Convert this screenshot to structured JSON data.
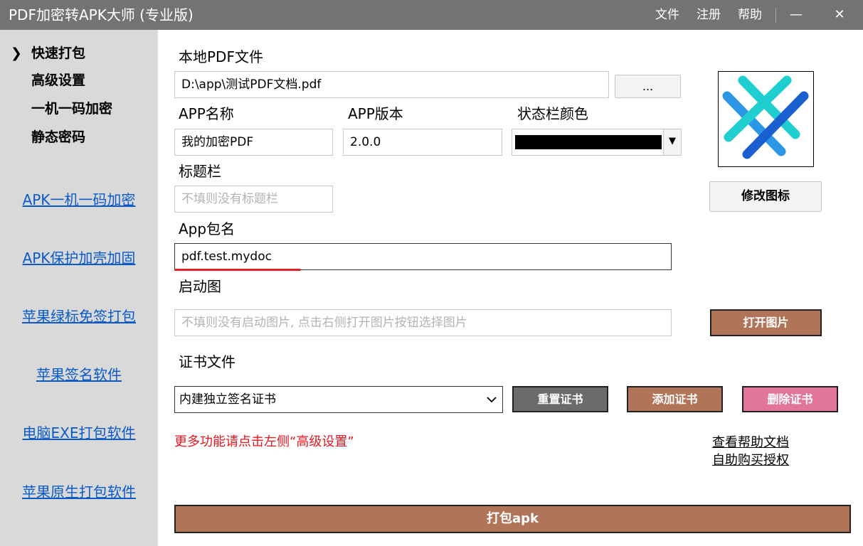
{
  "window": {
    "title": "PDF加密转APK大师 (专业版)",
    "menu": [
      "文件",
      "注册",
      "帮助"
    ],
    "minimize_glyph": "—",
    "close_glyph": "✕"
  },
  "sidebar": {
    "active_marker": "❯",
    "nav": [
      "快速打包",
      "高级设置",
      "一机一码加密",
      "静态密码"
    ],
    "links": [
      "APK一机一码加密",
      "APK保护加壳加固",
      "苹果绿标免签打包",
      "苹果签名软件",
      "电脑EXE打包软件",
      "苹果原生打包软件"
    ]
  },
  "main": {
    "pdf_label": "本地PDF文件",
    "pdf_path": "D:\\app\\测试PDF文档.pdf",
    "browse_label": "...",
    "app_name_label": "APP名称",
    "app_name_value": "我的加密PDF",
    "app_version_label": "APP版本",
    "app_version_value": "2.0.0",
    "statusbar_color_label": "状态栏颜色",
    "statusbar_color_value": "#000000",
    "titlebar_label": "标题栏",
    "titlebar_placeholder": "不填则没有标题栏",
    "package_label": "App包名",
    "package_value": "pdf.test.mydoc",
    "splash_label": "启动图",
    "splash_placeholder": "不填则没有启动图片, 点击右侧打开图片按钮选择图片",
    "open_image_label": "打开图片",
    "change_icon_label": "修改图标",
    "cert_label": "证书文件",
    "cert_value": "内建独立签名证书",
    "reset_cert_label": "重置证书",
    "add_cert_label": "添加证书",
    "delete_cert_label": "删除证书",
    "notice": "更多功能请点击左侧“高级设置”",
    "help_link": "查看帮助文档",
    "buy_link": "自助购买授权",
    "pack_label": "打包apk"
  },
  "colors": {
    "titlebar": "#737373",
    "sidebar": "#d9d9d9",
    "link_blue": "#0a5bc9",
    "brown_button": "#b07558",
    "gray_button": "#6b6b6b",
    "pink_button": "#e2759a",
    "notice_red": "#e8161f",
    "icon_cyan": "#1fcfd0",
    "icon_blue": "#1a5fd0",
    "icon_light_blue": "#2b97e6"
  }
}
